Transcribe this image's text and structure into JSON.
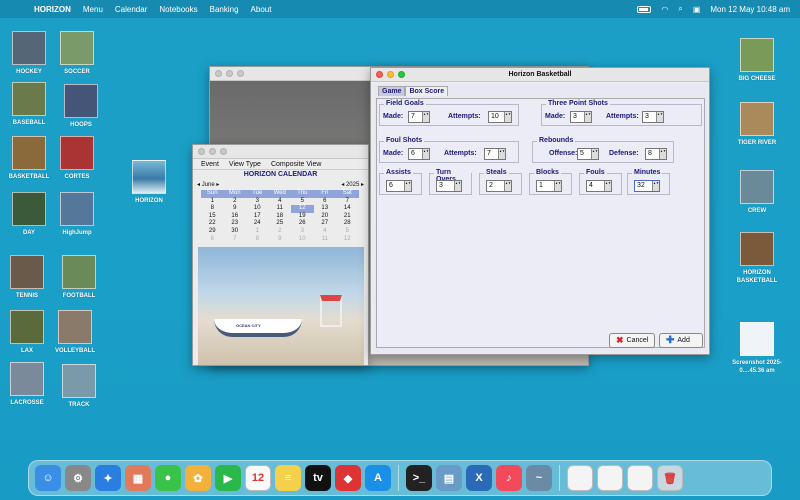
{
  "menubar": {
    "apple": "",
    "app": "HORIZON",
    "items": [
      "Menu",
      "Calendar",
      "Notebooks",
      "Banking",
      "About"
    ],
    "datetime": "Mon 12 May  10:48 am"
  },
  "desktop_left": [
    {
      "label": "HOCKEY",
      "color": "#556677"
    },
    {
      "label": "SOCCER",
      "color": "#7a9a6a"
    },
    {
      "label": "BASEBALL",
      "color": "#6a7a4a"
    },
    {
      "label": "HOOPS",
      "color": "#445577"
    },
    {
      "label": "BASKETBALL",
      "color": "#8a6a3a"
    },
    {
      "label": "CORTES",
      "color": "#aa3333"
    },
    {
      "label": "DAY",
      "color": "#3a5a3a"
    },
    {
      "label": "HighJump",
      "color": "#557799"
    },
    {
      "label": "TENNIS",
      "color": "#6a5a4a"
    },
    {
      "label": "FOOTBALL",
      "color": "#6a8a5a"
    },
    {
      "label": "LAX",
      "color": "#5a6a3a"
    },
    {
      "label": "VOLLEYBALL",
      "color": "#8a7a6a"
    },
    {
      "label": "LACROSSE",
      "color": "#7a8a9a"
    },
    {
      "label": "TRACK",
      "color": "#7a9aaa"
    }
  ],
  "desktop_mid": {
    "label": "HORIZON"
  },
  "desktop_right": [
    {
      "label": "BIG CHEESE",
      "color": "#7a9a5a"
    },
    {
      "label": "TIGER RIVER",
      "color": "#aa8a5a"
    },
    {
      "label": "CREW",
      "color": "#6a8a9a"
    },
    {
      "label": "HORIZON BASKETBALL",
      "color": "#7a5a3a"
    },
    {
      "label": "Screenshot 2025-0....45.36 am",
      "color": "#eef4f8"
    }
  ],
  "basketball": {
    "title": "Horizon Basketball",
    "tabs": [
      "Game",
      "Box Score"
    ],
    "field_goals": {
      "title": "Field Goals",
      "made_label": "Made:",
      "made": "7",
      "att_label": "Attempts:",
      "att": "10"
    },
    "three_point": {
      "title": "Three Point Shots",
      "made_label": "Made:",
      "made": "3",
      "att_label": "Attempts:",
      "att": "3"
    },
    "foul_shots": {
      "title": "Foul Shots",
      "made_label": "Made:",
      "made": "6",
      "att_label": "Attempts:",
      "att": "7"
    },
    "rebounds": {
      "title": "Rebounds",
      "off_label": "Offense:",
      "off": "5",
      "def_label": "Defense:",
      "def": "8"
    },
    "assists": {
      "title": "Assists",
      "val": "6"
    },
    "turnovers": {
      "title": "Turn Overs",
      "val": "3"
    },
    "steals": {
      "title": "Steals",
      "val": "2"
    },
    "blocks": {
      "title": "Blocks",
      "val": "1"
    },
    "fouls": {
      "title": "Fouls",
      "val": "4"
    },
    "minutes": {
      "title": "Minutes",
      "val": "32"
    },
    "cancel": "Cancel",
    "add": "Add"
  },
  "calendar": {
    "menu": [
      "Event",
      "View Type",
      "Composite View"
    ],
    "title": "HORIZON CALENDAR",
    "month": "June",
    "year": "2025",
    "days": [
      "Sun",
      "Mon",
      "Tue",
      "Wed",
      "Thu",
      "Fri",
      "Sat"
    ],
    "weeks": [
      [
        "1",
        "2",
        "3",
        "4",
        "5",
        "6",
        "7"
      ],
      [
        "8",
        "9",
        "10",
        "11",
        "12",
        "13",
        "14"
      ],
      [
        "15",
        "16",
        "17",
        "18",
        "19",
        "20",
        "21"
      ],
      [
        "22",
        "23",
        "24",
        "25",
        "26",
        "27",
        "28"
      ],
      [
        "29",
        "30",
        "1",
        "2",
        "3",
        "4",
        "5"
      ],
      [
        "6",
        "7",
        "8",
        "9",
        "10",
        "11",
        "12"
      ]
    ],
    "today": "12"
  },
  "dock": [
    {
      "name": "finder-icon",
      "glyph": "☺",
      "color": "#3a8ee6"
    },
    {
      "name": "system-settings-icon",
      "glyph": "⚙",
      "color": "#888"
    },
    {
      "name": "safari-icon",
      "glyph": "✦",
      "color": "#2a7ee0"
    },
    {
      "name": "launchpad-icon",
      "glyph": "▦",
      "color": "#e07a5a"
    },
    {
      "name": "messages-icon",
      "glyph": "●",
      "color": "#3ac34a"
    },
    {
      "name": "photos-icon",
      "glyph": "✿",
      "color": "#f3b13b"
    },
    {
      "name": "facetime-icon",
      "glyph": "▶",
      "color": "#2ab84a"
    },
    {
      "name": "calendar-icon",
      "glyph": "12",
      "color": "#fafafa"
    },
    {
      "name": "notes-icon",
      "glyph": "≡",
      "color": "#f5d04a"
    },
    {
      "name": "tv-icon",
      "glyph": "tv",
      "color": "#111"
    },
    {
      "name": "red-app-icon",
      "glyph": "◆",
      "color": "#d33"
    },
    {
      "name": "app-store-icon",
      "glyph": "A",
      "color": "#1a8fe8"
    },
    {
      "name": "terminal-icon",
      "glyph": ">_",
      "color": "#222"
    },
    {
      "name": "preview-icon",
      "glyph": "▤",
      "color": "#6a9ac6"
    },
    {
      "name": "xquartz-icon",
      "glyph": "X",
      "color": "#2a6ab6"
    },
    {
      "name": "music-icon",
      "glyph": "♪",
      "color": "#f24a5a"
    },
    {
      "name": "wave-app-icon",
      "glyph": "~",
      "color": "#6a8aa6"
    },
    {
      "name": "document-1-icon",
      "glyph": "",
      "color": "#f4f4f4"
    },
    {
      "name": "document-2-icon",
      "glyph": "",
      "color": "#f4f4f4"
    },
    {
      "name": "document-3-icon",
      "glyph": "",
      "color": "#f4f4f4"
    },
    {
      "name": "trash-icon",
      "glyph": "🗑",
      "color": "#c8d8e0"
    }
  ]
}
